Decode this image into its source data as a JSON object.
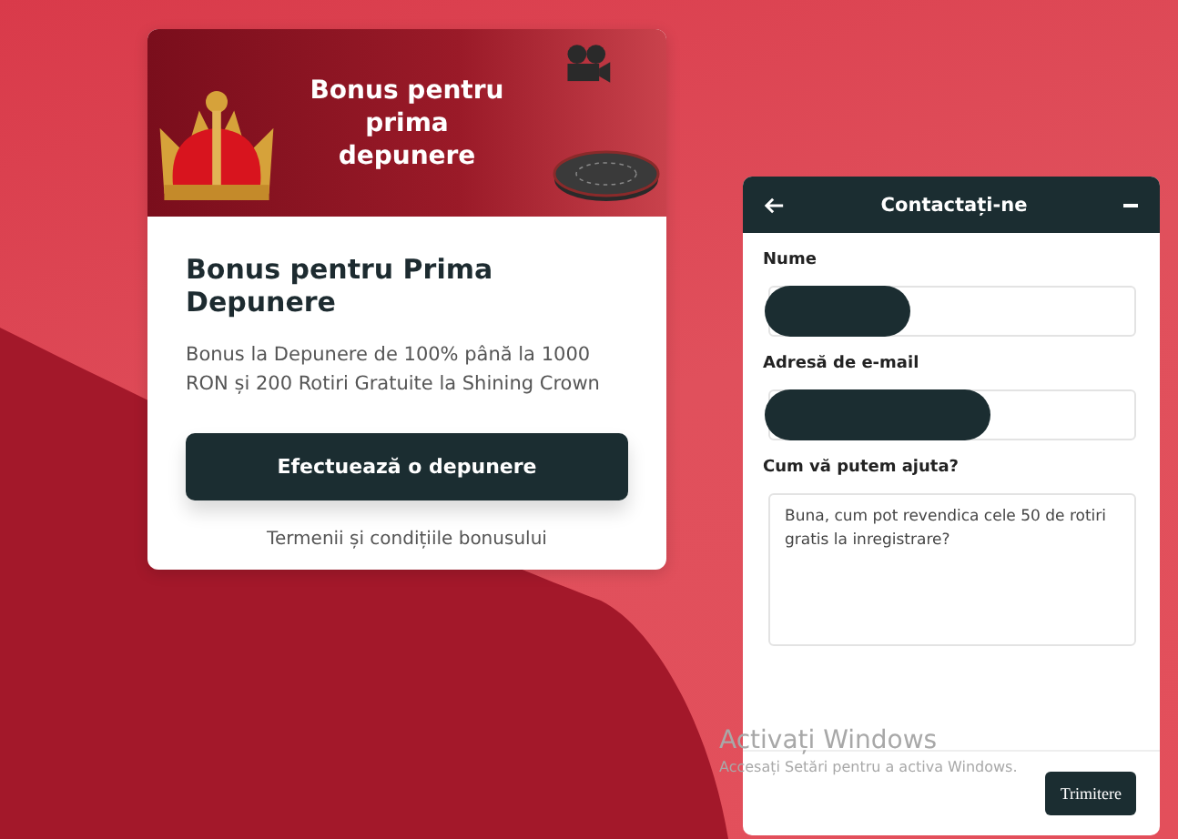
{
  "bonus_card": {
    "banner_title": "Bonus pentru prima depunere",
    "title": "Bonus pentru Prima Depunere",
    "description": "Bonus la Depunere de 100% până la 1000 RON și 200 Rotiri Gratuite la Shining Crown",
    "button": "Efectuează o depunere",
    "terms_link": "Termenii și condițiile bonusului"
  },
  "contact_panel": {
    "title": "Contactați-ne",
    "fields": [
      {
        "kind": "input",
        "label": "Nume",
        "redacted": true
      },
      {
        "kind": "input",
        "label": "Adresă de e-mail",
        "redacted": true
      },
      {
        "kind": "textarea",
        "label": "Cum vă putem ajuta?",
        "value": "Buna, cum pot revendica cele 50 de rotiri gratis la inregistrare?"
      }
    ],
    "submit_button": "Trimitere"
  },
  "os_overlay": {
    "title": "Activați Windows",
    "subtitle": "Accesați Setări pentru a activa Windows."
  }
}
